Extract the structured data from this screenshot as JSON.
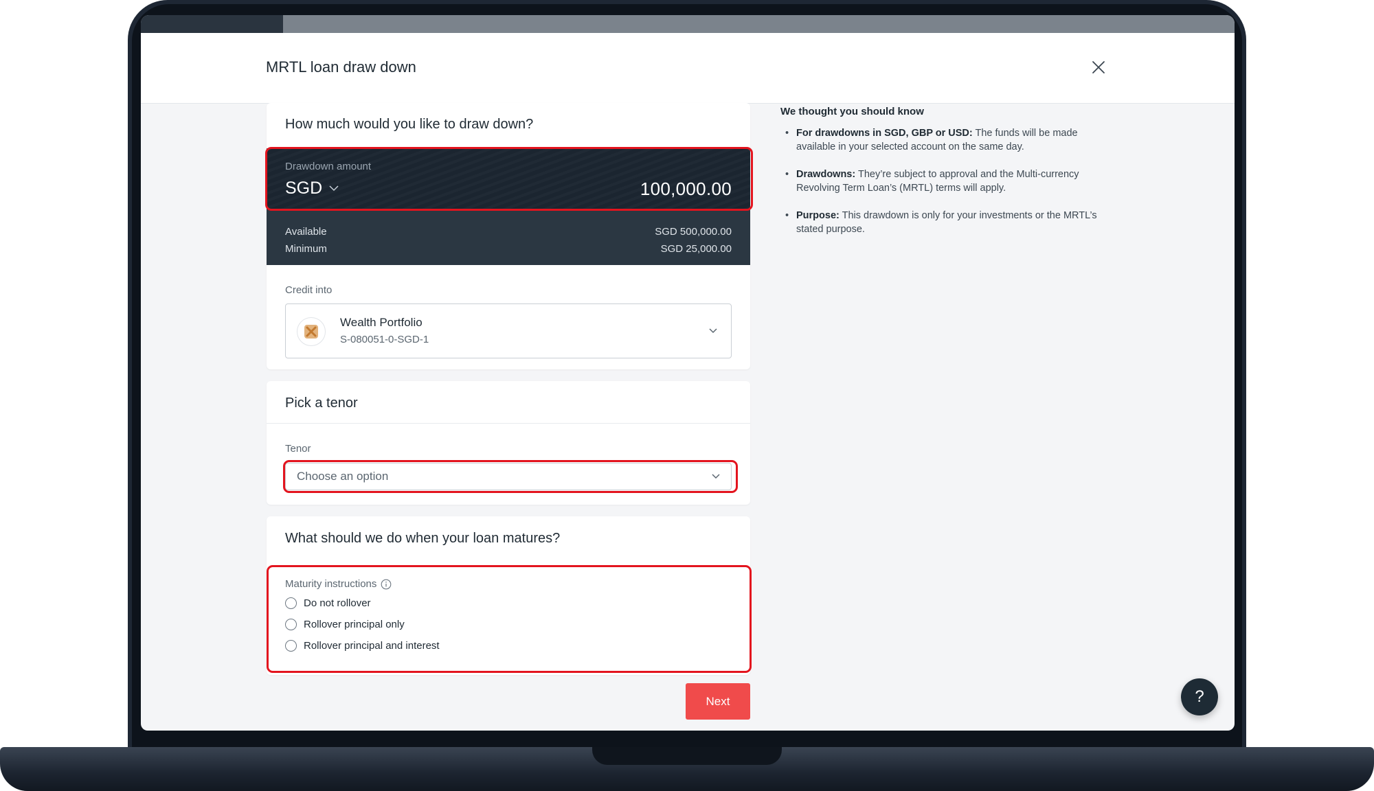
{
  "progress": {
    "fraction": 0.13
  },
  "header": {
    "title": "MRTL loan draw down",
    "close_icon": "close-icon"
  },
  "drawdown_card": {
    "title": "How much would you like to draw down?",
    "amount_label": "Drawdown amount",
    "currency": "SGD",
    "amount": "100,000.00",
    "available_label": "Available",
    "available_value": "SGD 500,000.00",
    "minimum_label": "Minimum",
    "minimum_value": "SGD 25,000.00",
    "credit_label": "Credit into",
    "account_name": "Wealth Portfolio",
    "account_number": "S-080051-0-SGD-1"
  },
  "tenor_card": {
    "title": "Pick a tenor",
    "tenor_label": "Tenor",
    "tenor_placeholder": "Choose an option"
  },
  "maturity_card": {
    "title": "What should we do when your loan matures?",
    "instructions_label": "Maturity instructions",
    "options": [
      "Do not rollover",
      "Rollover principal only",
      "Rollover principal and interest"
    ]
  },
  "next_label": "Next",
  "info_panel": {
    "title": "We thought you should know",
    "items": [
      {
        "bold": "For drawdowns in SGD, GBP or USD:",
        "text": " The funds will be made available in your selected account on the same day."
      },
      {
        "bold": "Drawdowns:",
        "text": " They’re subject to approval and the Multi-currency Revolving Term Loan’s (MRTL) terms will apply."
      },
      {
        "bold": "Purpose:",
        "text": " This drawdown is only for your investments or the MRTL’s stated purpose."
      }
    ]
  },
  "help_label": "?",
  "colors": {
    "accent": "#f04b4b",
    "highlight": "#e3141e",
    "dark_panel": "#1b2530"
  }
}
